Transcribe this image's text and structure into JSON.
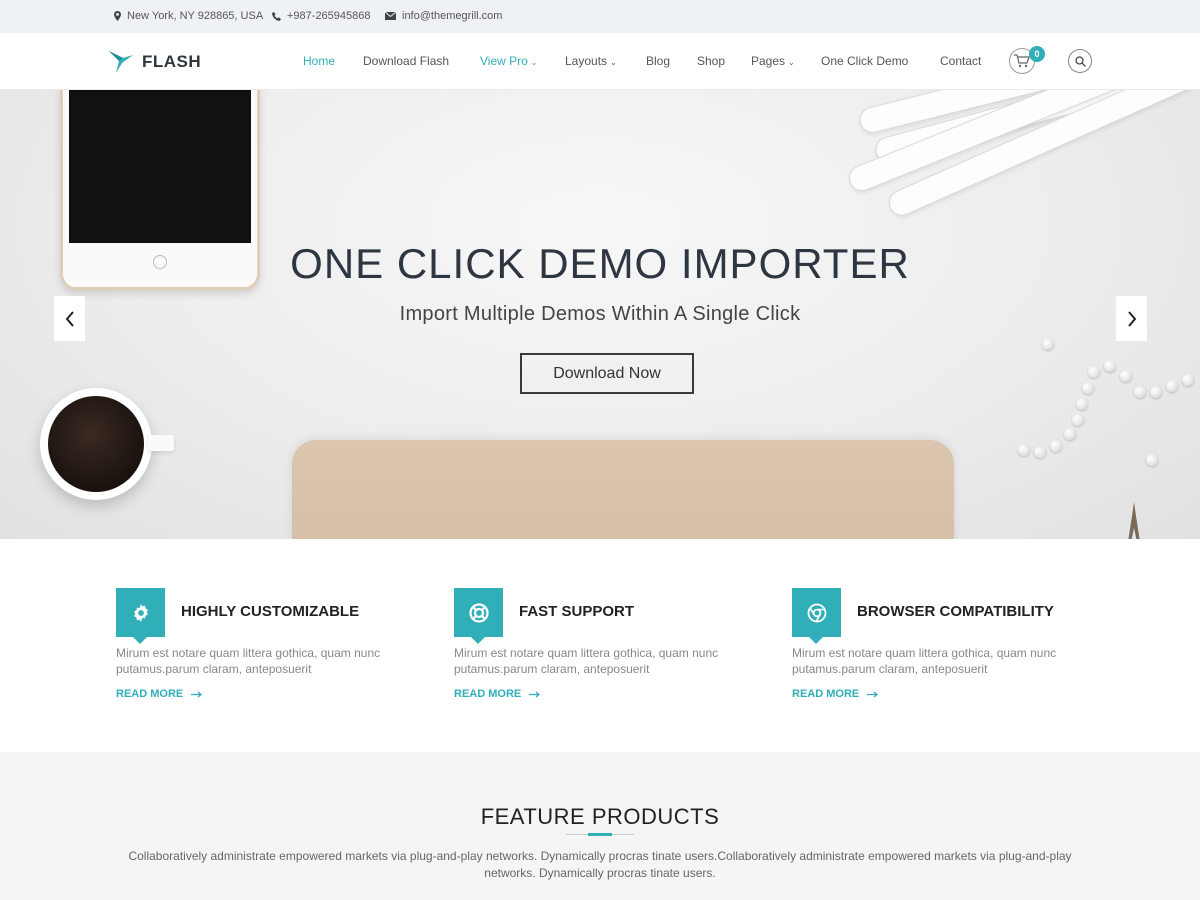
{
  "topbar": {
    "location": "New York, NY 928865, USA",
    "phone": "+987-265945868",
    "email": "info@themegrill.com"
  },
  "header": {
    "logo_text": "FLASH",
    "nav": [
      {
        "label": "Home"
      },
      {
        "label": "Download Flash"
      },
      {
        "label": "View Pro"
      },
      {
        "label": "Layouts"
      },
      {
        "label": "Blog"
      },
      {
        "label": "Shop"
      },
      {
        "label": "Pages"
      },
      {
        "label": "One Click Demo"
      },
      {
        "label": "Contact"
      }
    ],
    "cart_count": "0"
  },
  "hero": {
    "title": "ONE CLICK DEMO IMPORTER",
    "subtitle": "Import Multiple Demos Within A Single Click",
    "button": "Download Now"
  },
  "features": [
    {
      "title": "HIGHLY CUSTOMIZABLE",
      "icon": "gear-icon",
      "desc": "Mirum est notare quam littera gothica, quam nunc putamus.parum claram, anteposuerit",
      "link": "READ MORE"
    },
    {
      "title": "FAST SUPPORT",
      "icon": "lifebuoy-icon",
      "desc": "Mirum est notare quam littera gothica, quam nunc putamus.parum claram, anteposuerit",
      "link": "READ MORE"
    },
    {
      "title": "BROWSER COMPATIBILITY",
      "icon": "chrome-icon",
      "desc": "Mirum est notare quam littera gothica, quam nunc putamus.parum claram, anteposuerit",
      "link": "READ MORE"
    }
  ],
  "feature_products": {
    "title": "FEATURE PRODUCTS",
    "desc": "Collaboratively administrate empowered markets via plug-and-play networks. Dynamically procras tinate users.Collaboratively administrate empowered markets via plug-and-play networks. Dynamically procras tinate users."
  },
  "colors": {
    "accent": "#30afb8",
    "topbar_bg": "#eef2f6",
    "heading": "#2e3642"
  }
}
